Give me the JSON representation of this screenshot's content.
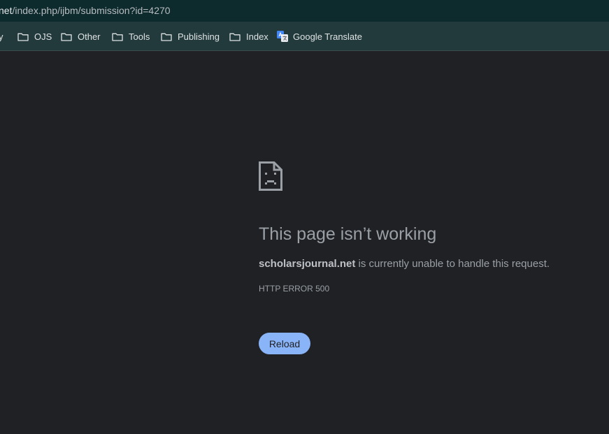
{
  "browser": {
    "url_host_fragment": "net",
    "url_path": "/index.php/ijbm/submission?id=4270",
    "bookmarks": [
      {
        "label": "y",
        "icon": "folder-icon",
        "partial": true
      },
      {
        "label": "OJS",
        "icon": "folder-icon"
      },
      {
        "label": "Other",
        "icon": "folder-icon"
      },
      {
        "label": "Tools",
        "icon": "folder-icon"
      },
      {
        "label": "Publishing",
        "icon": "folder-icon"
      },
      {
        "label": "Index",
        "icon": "folder-icon"
      },
      {
        "label": "Google Translate",
        "icon": "google-translate-icon"
      }
    ]
  },
  "error": {
    "icon": "sad-page-icon",
    "title": "This page isn’t working",
    "domain": "scholarsjournal.net",
    "message": " is currently unable to handle this request.",
    "code": "HTTP ERROR 500",
    "reload_label": "Reload"
  },
  "colors": {
    "page_background": "#202124",
    "address_bar_background": "#0d2a2c",
    "bookmarks_bar_background": "#223a3c",
    "reload_button": "#8ab4f8",
    "text_muted": "#9aa0a6"
  }
}
